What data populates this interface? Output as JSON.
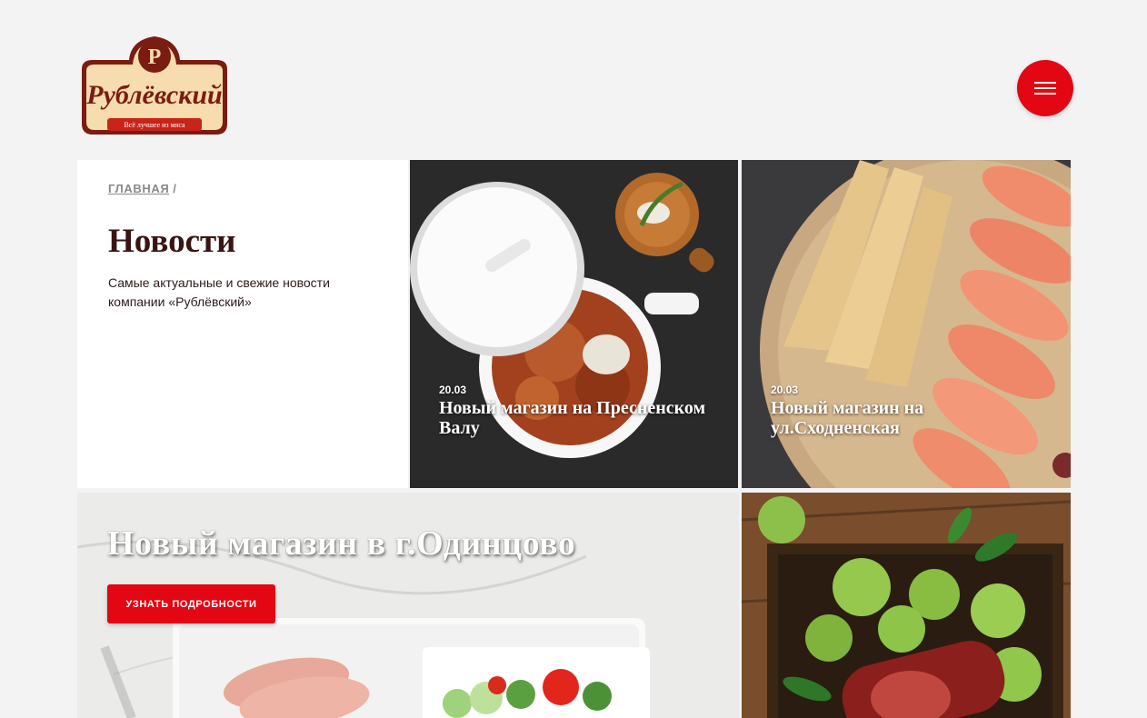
{
  "brand": {
    "name": "Рублёвский",
    "monogram": "Р",
    "tagline": "Всё лучшее из мяса"
  },
  "header": {
    "menu_icon": "hamburger-icon"
  },
  "breadcrumb": {
    "home": "ГЛАВНАЯ",
    "separator": "/"
  },
  "page": {
    "title": "Новости",
    "description": "Самые актуальные и свежие новости компании «Рублёвский»"
  },
  "news": [
    {
      "date": "20.03",
      "title": "Новый магазин на Пресненском Валу"
    },
    {
      "date": "20.03",
      "title": "Новый магазин на ул.Сходненская"
    }
  ],
  "banner": {
    "title": "Новый магазин в г.Одинцово",
    "button": "УЗНАТЬ ПОДРОБНОСТИ"
  },
  "colors": {
    "accent": "#e30613",
    "title": "#3a1414",
    "background": "#f3f3f3"
  }
}
